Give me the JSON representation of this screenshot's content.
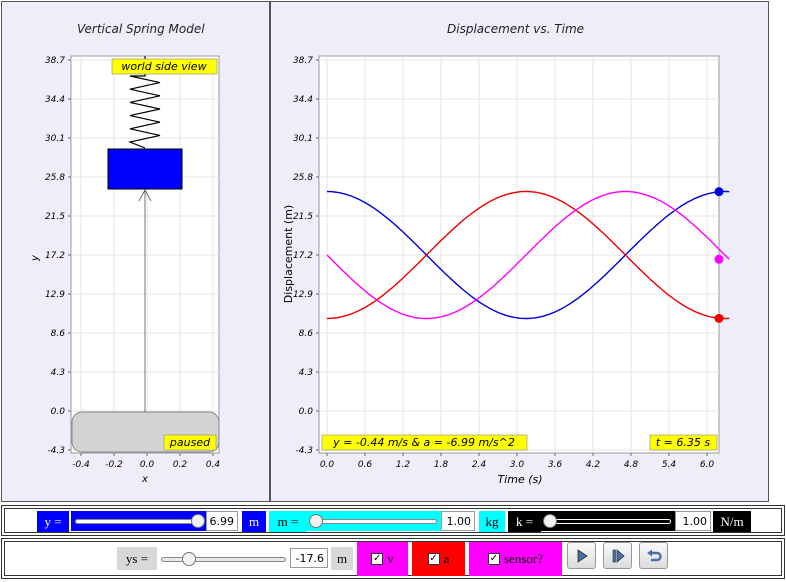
{
  "left_panel": {
    "title": "Vertical Spring Model",
    "y_ticks": [
      "38.7",
      "34.4",
      "30.1",
      "25.8",
      "21.5",
      "17.2",
      "12.9",
      "8.6",
      "4.3",
      "0.0",
      "-4.3"
    ],
    "x_ticks": [
      "-0.4",
      "-0.2",
      "0.0",
      "0.2",
      "0.4"
    ],
    "xlabel": "x",
    "ylabel": "y",
    "view_label": "world side view",
    "status_label": "paused",
    "mass_color": "#0000ff",
    "label_color": "#ffff00"
  },
  "chart_data": {
    "type": "line",
    "title": "Displacement vs. Time",
    "xlabel": "Time (s)",
    "ylabel": "Displacement (m)",
    "x_ticks": [
      "0.0",
      "0.6",
      "1.2",
      "1.8",
      "2.4",
      "3.0",
      "3.6",
      "4.2",
      "4.8",
      "5.4",
      "6.0"
    ],
    "y_ticks": [
      "38.7",
      "34.4",
      "30.1",
      "25.8",
      "21.5",
      "17.2",
      "12.9",
      "8.6",
      "4.3",
      "0.0",
      "-4.3"
    ],
    "xlim": [
      -0.3,
      6.35
    ],
    "ylim": [
      -4.3,
      39.7
    ],
    "grid": true,
    "series": [
      {
        "color": "#0000dd",
        "equilibrium": 17.2,
        "amplitude": 7.0,
        "omega": 1.0,
        "phase": 0.0,
        "marker_end": true
      },
      {
        "color": "#ee0000",
        "equilibrium": 17.2,
        "amplitude": 7.0,
        "omega": 1.0,
        "phase": 3.1416,
        "marker_end": true
      },
      {
        "color": "#ff00ff",
        "equilibrium": 17.2,
        "amplitude": 7.0,
        "omega": 1.0,
        "phase": 1.5708,
        "marker_end": true
      }
    ],
    "t_start": 0.0,
    "t_end": 6.35,
    "readout": "y = -0.44 m/s & a = -6.99 m/s^2",
    "time_readout": "t = 6.35 s"
  },
  "controls": {
    "y_label": "y =",
    "y_value": "6.99",
    "y_unit": "m",
    "y_slider_level": 1.0,
    "m_label": "m =",
    "m_value": "1.00",
    "m_unit": "kg",
    "m_slider_level": 0.0,
    "k_label": "k =",
    "k_value": "1.00",
    "k_unit": "N/m",
    "k_slider_level": 0.0,
    "ys_label": "ys =",
    "ys_value": "-17.6",
    "ys_unit": "m",
    "ys_slider_level": 0.2,
    "v_label": "v",
    "a_label": "a",
    "sensor_label": "sensor?",
    "check_mark": "✓",
    "colors": {
      "blue": "#0000ff",
      "cyan": "#00ffff",
      "black": "#000000",
      "magenta": "#ff00ff",
      "red": "#ff0000",
      "gray": "#d8d8d8"
    }
  }
}
